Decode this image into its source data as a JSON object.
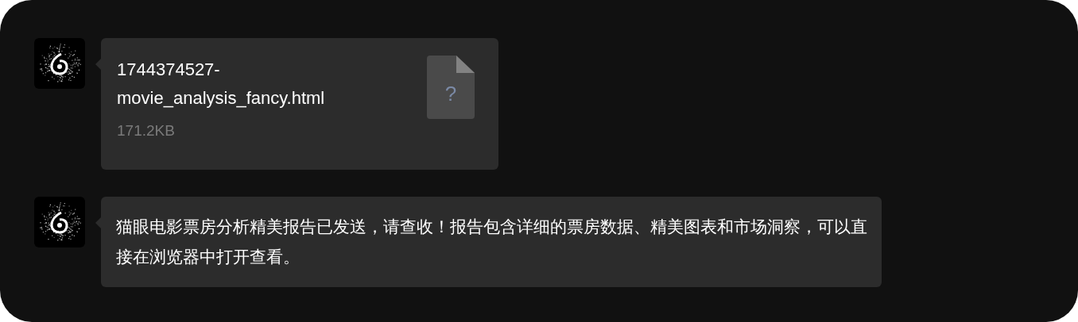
{
  "messages": [
    {
      "kind": "file",
      "file_name_lines": [
        "1744374527-",
        "movie_analysis_fancy.html"
      ],
      "file_size": "171.2KB",
      "file_icon_glyph": "?"
    },
    {
      "kind": "text",
      "text": "猫眼电影票房分析精美报告已发送，请查收！报告包含详细的票房数据、精美图表和市场洞察，可以直接在浏览器中打开查看。"
    }
  ]
}
